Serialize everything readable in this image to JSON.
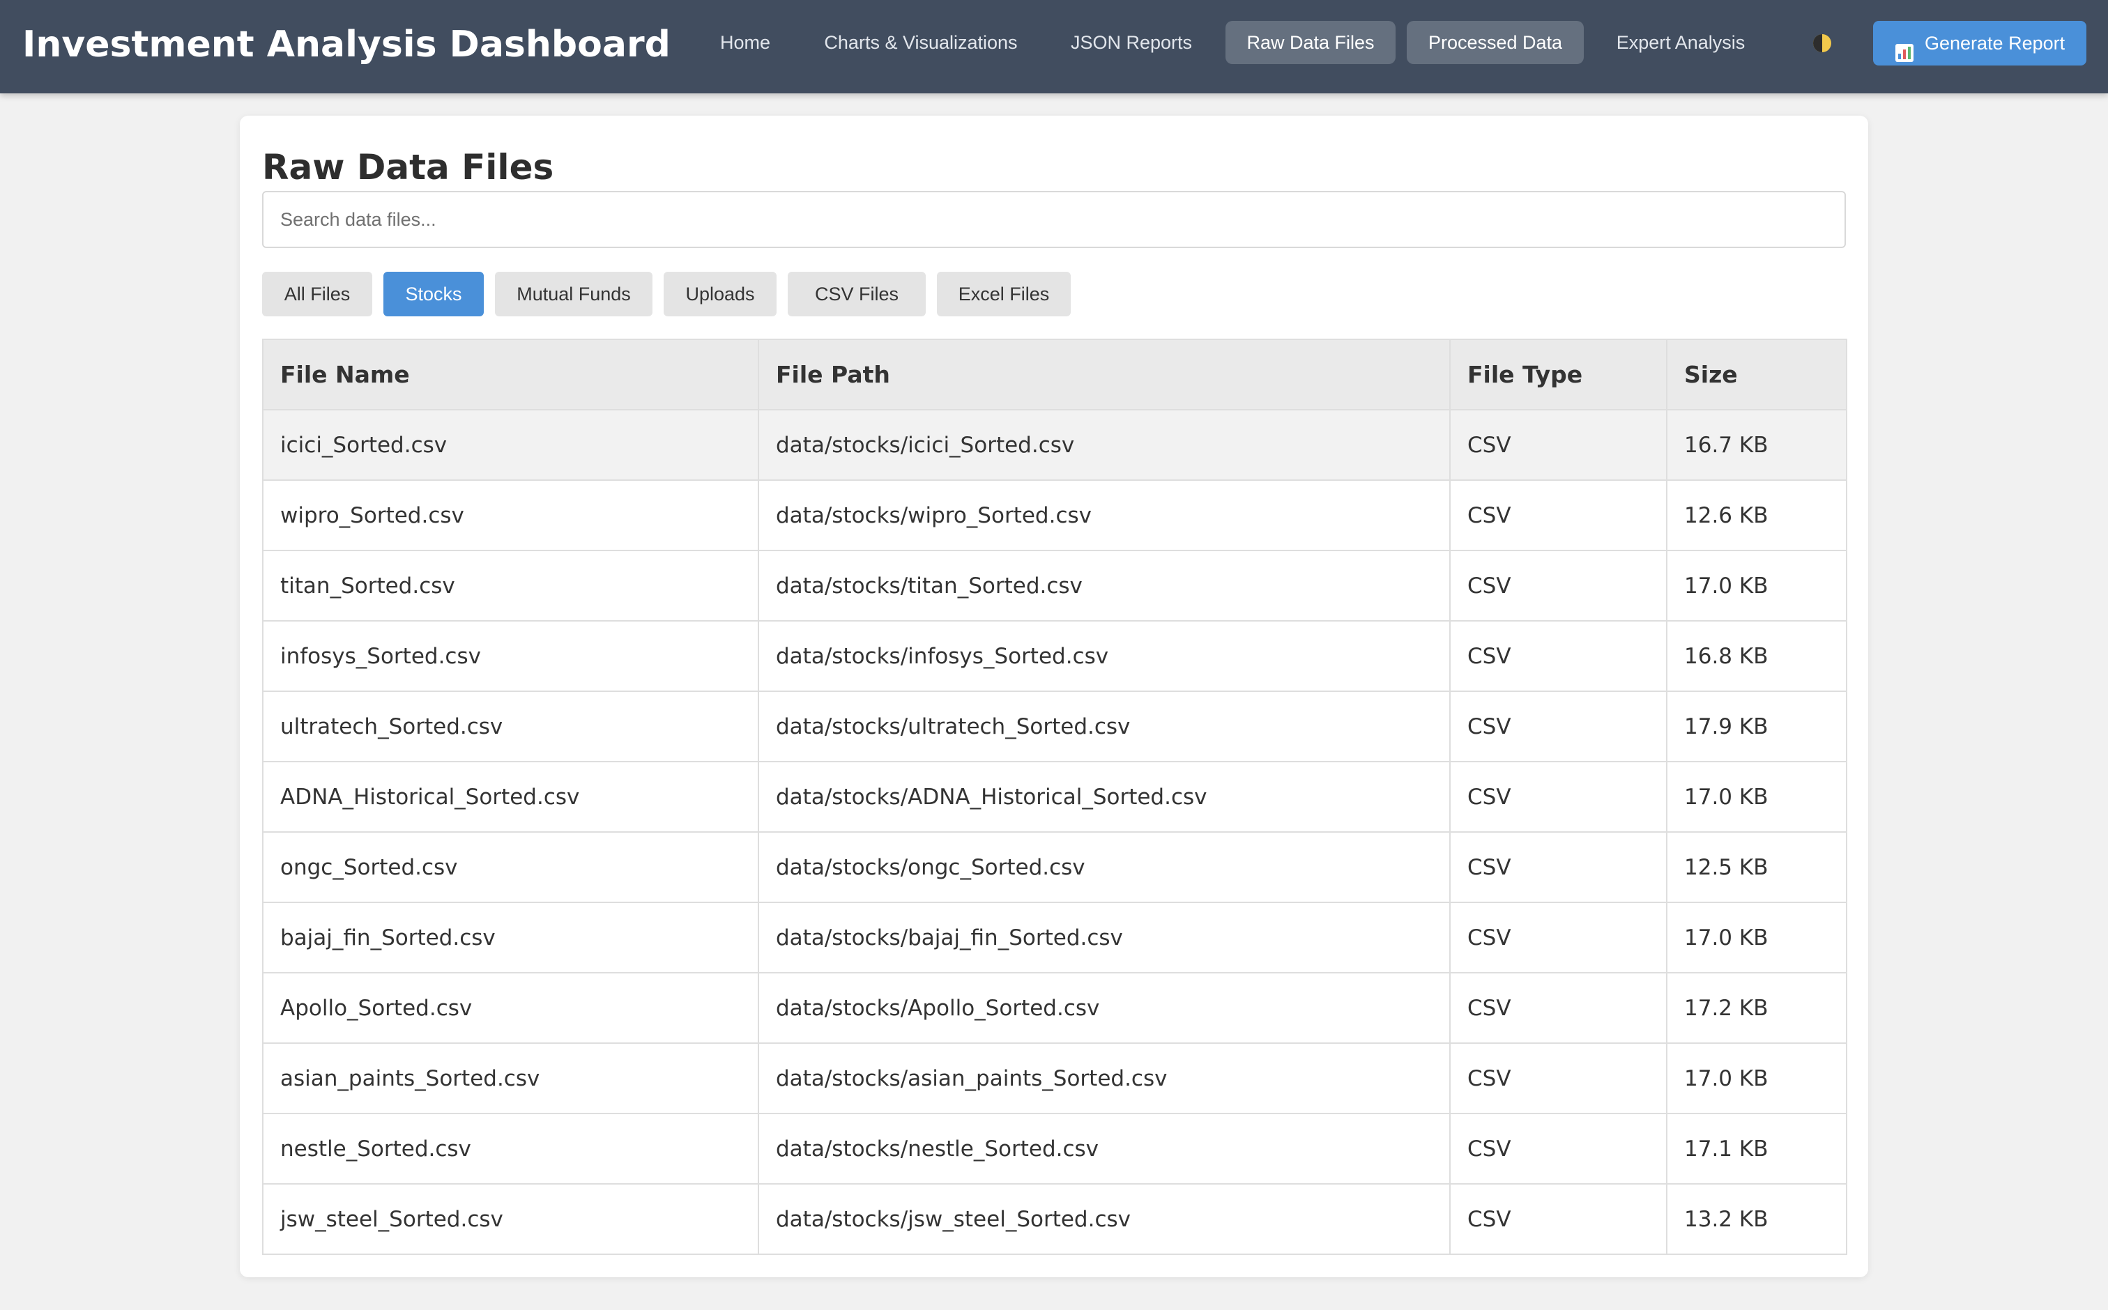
{
  "app": {
    "title": "Investment Analysis Dashboard"
  },
  "nav": {
    "items": [
      {
        "label": "Home"
      },
      {
        "label": "Charts & Visualizations"
      },
      {
        "label": "JSON Reports"
      },
      {
        "label": "Raw Data Files"
      },
      {
        "label": "Processed Data"
      },
      {
        "label": "Expert Analysis"
      }
    ],
    "theme_toggle_icon": "half-moon-icon",
    "generate_icon": "bar-chart-icon",
    "generate_label": "Generate Report"
  },
  "page": {
    "title": "Raw Data Files",
    "search_placeholder": "Search data files..."
  },
  "filters": [
    {
      "label": "All Files"
    },
    {
      "label": "Stocks"
    },
    {
      "label": "Mutual Funds"
    },
    {
      "label": "Uploads"
    },
    {
      "label": "CSV Files"
    },
    {
      "label": "Excel Files"
    }
  ],
  "active_filter": "Stocks",
  "table": {
    "headers": [
      "File Name",
      "File Path",
      "File Type",
      "Size"
    ],
    "rows": [
      {
        "name": "icici_Sorted.csv",
        "path": "data/stocks/icici_Sorted.csv",
        "type": "CSV",
        "size": "16.7 KB"
      },
      {
        "name": "wipro_Sorted.csv",
        "path": "data/stocks/wipro_Sorted.csv",
        "type": "CSV",
        "size": "12.6 KB"
      },
      {
        "name": "titan_Sorted.csv",
        "path": "data/stocks/titan_Sorted.csv",
        "type": "CSV",
        "size": "17.0 KB"
      },
      {
        "name": "infosys_Sorted.csv",
        "path": "data/stocks/infosys_Sorted.csv",
        "type": "CSV",
        "size": "16.8 KB"
      },
      {
        "name": "ultratech_Sorted.csv",
        "path": "data/stocks/ultratech_Sorted.csv",
        "type": "CSV",
        "size": "17.9 KB"
      },
      {
        "name": "ADNA_Historical_Sorted.csv",
        "path": "data/stocks/ADNA_Historical_Sorted.csv",
        "type": "CSV",
        "size": "17.0 KB"
      },
      {
        "name": "ongc_Sorted.csv",
        "path": "data/stocks/ongc_Sorted.csv",
        "type": "CSV",
        "size": "12.5 KB"
      },
      {
        "name": "bajaj_fin_Sorted.csv",
        "path": "data/stocks/bajaj_fin_Sorted.csv",
        "type": "CSV",
        "size": "17.0 KB"
      },
      {
        "name": "Apollo_Sorted.csv",
        "path": "data/stocks/Apollo_Sorted.csv",
        "type": "CSV",
        "size": "17.2 KB"
      },
      {
        "name": "asian_paints_Sorted.csv",
        "path": "data/stocks/asian_paints_Sorted.csv",
        "type": "CSV",
        "size": "17.0 KB"
      },
      {
        "name": "nestle_Sorted.csv",
        "path": "data/stocks/nestle_Sorted.csv",
        "type": "CSV",
        "size": "17.1 KB"
      },
      {
        "name": "jsw_steel_Sorted.csv",
        "path": "data/stocks/jsw_steel_Sorted.csv",
        "type": "CSV",
        "size": "13.2 KB"
      }
    ]
  },
  "colors": {
    "header_bg": "#414d5f",
    "accent": "#4a90d9",
    "nav_highlight": "#65707f",
    "page_bg": "#f1f1f1"
  }
}
